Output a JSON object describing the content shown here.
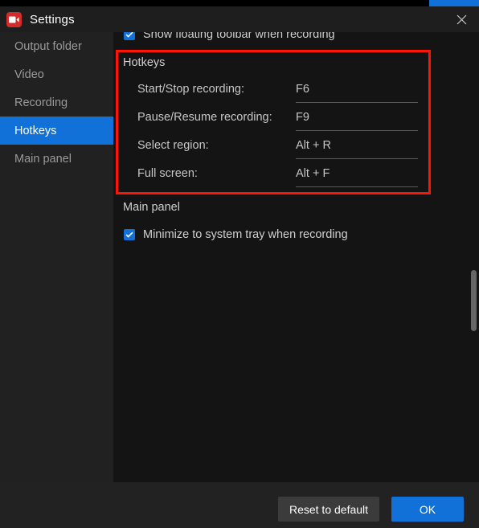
{
  "window": {
    "title": "Settings",
    "logo_icon": "video-camera-icon",
    "close_icon": "close-icon"
  },
  "sidebar": {
    "items": [
      {
        "label": "Output folder",
        "selected": false
      },
      {
        "label": "Video",
        "selected": false
      },
      {
        "label": "Recording",
        "selected": false
      },
      {
        "label": "Hotkeys",
        "selected": true
      },
      {
        "label": "Main panel",
        "selected": false
      }
    ]
  },
  "content": {
    "clipped_row": {
      "label": "Show floating toolbar when recording",
      "checked": true
    },
    "hotkeys": {
      "title": "Hotkeys",
      "rows": [
        {
          "label": "Start/Stop recording:",
          "value": "F6"
        },
        {
          "label": "Pause/Resume recording:",
          "value": "F9"
        },
        {
          "label": "Select region:",
          "value": "Alt + R"
        },
        {
          "label": "Full screen:",
          "value": "Alt + F"
        }
      ]
    },
    "main_panel": {
      "title": "Main panel",
      "checkbox_label": "Minimize to system tray when recording",
      "checked": true
    }
  },
  "footer": {
    "reset_label": "Reset to default",
    "ok_label": "OK"
  },
  "colors": {
    "accent_blue": "#1271d8",
    "annotation_red": "#fc1507",
    "logo_red": "#d32a2a",
    "sidebar_bg": "#212121",
    "content_bg": "#141414",
    "footer_bg": "#222222"
  }
}
